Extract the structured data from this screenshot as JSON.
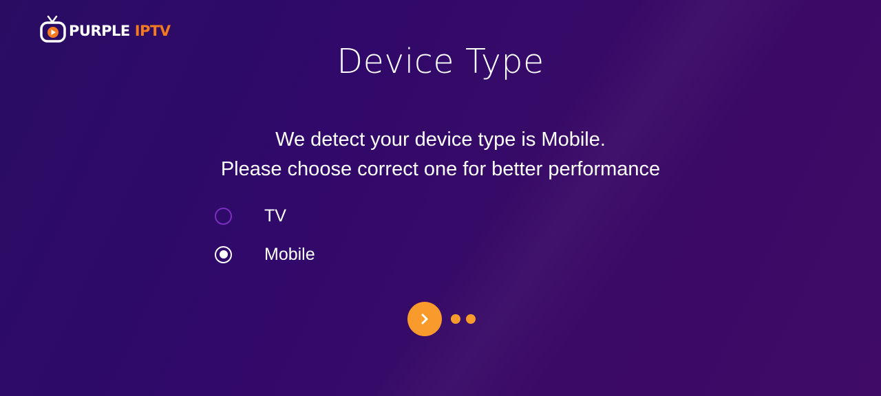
{
  "logo": {
    "word_primary": "PURPLE",
    "word_secondary": "IPTV",
    "icon": "tv-play-icon"
  },
  "page": {
    "title": "Device Type",
    "message_line1": "We detect your device type is Mobile.",
    "message_line2": "Please choose correct one for better performance"
  },
  "options": [
    {
      "label": "TV",
      "selected": false
    },
    {
      "label": "Mobile",
      "selected": true
    }
  ],
  "navigation": {
    "next_icon": "chevron-right-icon",
    "page_indicator_count": 2
  },
  "colors": {
    "background": "#2e0b66",
    "accent": "#f99a2c",
    "logo_accent": "#f47a1f",
    "radio_unselected": "#7a2fbf",
    "text": "#ffffff"
  }
}
